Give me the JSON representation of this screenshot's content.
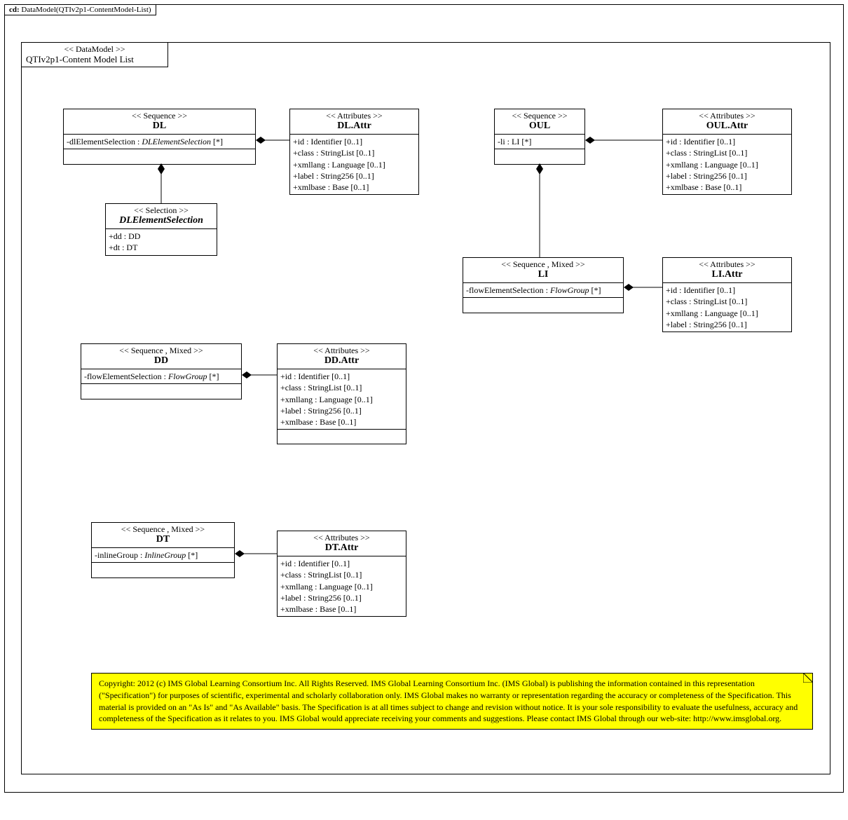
{
  "frame": {
    "tab_prefix": "cd:",
    "tab_title": "DataModel(QTIv2p1-ContentModel-List)"
  },
  "header_box": {
    "stereo": "<< DataModel >>",
    "title": "QTIv2p1-Content Model List"
  },
  "boxes": {
    "DL": {
      "stereo": "<< Sequence >>",
      "title": "DL",
      "attrs": [
        {
          "text": "-dlElementSelection  :",
          "type": "DLElementSelection",
          "card": " [*]"
        }
      ]
    },
    "DLAttr": {
      "stereo": "<<  Attributes  >>",
      "title": "DL.Attr",
      "attrs": [
        "+id : Identifier [0..1]",
        "+class : StringList [0..1]",
        "+xmllang  : Language [0..1]",
        "+label : String256 [0..1]",
        "+xmlbase : Base [0..1]"
      ]
    },
    "DLElSel": {
      "stereo": "<< Selection  >>",
      "title": "DLElementSelection",
      "title_italic": true,
      "attrs": [
        "+dd : DD",
        "+dt : DT"
      ]
    },
    "DD": {
      "stereo": "<< Sequence , Mixed >>",
      "title": "DD",
      "attrs": [
        {
          "text": "-flowElementSelection   :",
          "type": "FlowGroup",
          "card": " [*]"
        }
      ]
    },
    "DDAttr": {
      "stereo": "<<  Attributes  >>",
      "title": "DD.Attr",
      "attrs": [
        "+id : Identifier [0..1]",
        "+class : StringList [0..1]",
        "+xmllang  : Language [0..1]",
        "+label : String256 [0..1]",
        "+xmlbase : Base [0..1]"
      ]
    },
    "DT": {
      "stereo": "<< Sequence , Mixed >>",
      "title": "DT",
      "attrs": [
        {
          "text": "-inlineGroup  :",
          "type": "InlineGroup",
          "card": " [*]"
        }
      ]
    },
    "DTAttr": {
      "stereo": "<<  Attributes  >>",
      "title": "DT.Attr",
      "attrs": [
        "+id : Identifier [0..1]",
        "+class : StringList [0..1]",
        "+xmllang  : Language [0..1]",
        "+label : String256 [0..1]",
        "+xmlbase : Base [0..1]"
      ]
    },
    "OUL": {
      "stereo": "<< Sequence >>",
      "title": "OUL",
      "attrs": [
        "-li : LI [*]"
      ]
    },
    "OULAttr": {
      "stereo": "<<  Attributes  >>",
      "title": "OUL.Attr",
      "attrs": [
        "+id : Identifier [0..1]",
        "+class : StringList [0..1]",
        "+xmllang  : Language [0..1]",
        "+label : String256 [0..1]",
        "+xmlbase : Base [0..1]"
      ]
    },
    "LI": {
      "stereo": "<< Sequence , Mixed >>",
      "title": "LI",
      "attrs": [
        {
          "text": "-flowElementSelection   :",
          "type": "FlowGroup",
          "card": " [*]"
        }
      ]
    },
    "LIAttr": {
      "stereo": "<<  Attributes  >>",
      "title": "LI.Attr",
      "attrs": [
        "+id : Identifier [0..1]",
        "+class : StringList [0..1]",
        "+xmllang  : Language [0..1]",
        "+label : String256 [0..1]"
      ]
    }
  },
  "copyright": "Copyright: 2012 (c) IMS Global Learning Consortium Inc.  All Rights Reserved.  IMS Global Learning Consortium Inc. (IMS Global) is publishing the information contained in this representation (\"Specification\") for purposes of scientific, experimental and scholarly collaboration only.  IMS Global makes no warranty or representation regarding the accuracy or completeness of the Specification.  This material is provided on an \"As Is\" and \"As Available\" basis.  The Specification is at all times subject to change and revision without notice.  It is your sole responsibility to evaluate the usefulness, accuracy and completeness of the Specification as it relates to you.  IMS Global would appreciate receiving your comments and suggestions.  Please contact IMS Global through our web-site: http://www.imsglobal.org."
}
